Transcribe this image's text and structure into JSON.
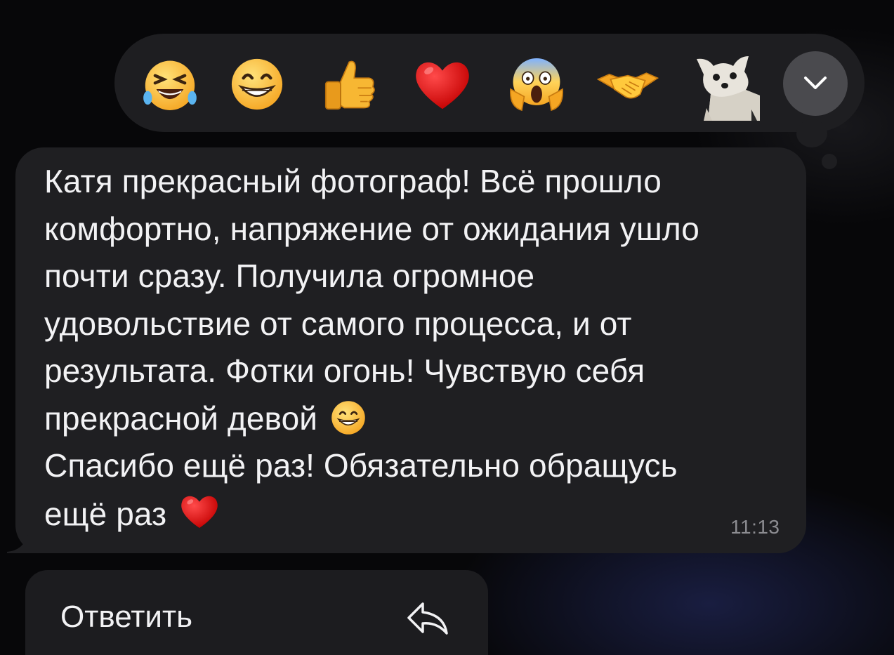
{
  "reactions": [
    {
      "name": "laughing-face-icon"
    },
    {
      "name": "grinning-face-icon"
    },
    {
      "name": "thumbs-up-icon"
    },
    {
      "name": "red-heart-icon"
    },
    {
      "name": "screaming-face-icon"
    },
    {
      "name": "handshake-icon"
    },
    {
      "name": "dog-sticker-icon"
    }
  ],
  "expand_icon": "chevron-down-icon",
  "message": {
    "lines": [
      "Катя прекрасный фотограф! Всё прошло",
      "комфортно, напряжение от ожидания ушло",
      "почти сразу. Получила огромное",
      "удовольствие от самого процесса, и от",
      "результата. Фотки огонь! Чувствую себя",
      "прекрасной девой",
      "Спасибо ещё раз! Обязательно обращусь",
      "ещё раз"
    ],
    "inline_emojis": [
      "grinning-face-icon",
      "red-heart-icon"
    ],
    "time": "11:13"
  },
  "context_menu": {
    "reply_label": "Ответить",
    "reply_icon": "reply-arrow-icon"
  },
  "colors": {
    "bubble": "#1f1f22",
    "reaction_bar": "#1e1e21",
    "text": "#f2f2f4",
    "timestamp": "#8c8c91",
    "expand_button": "#4a4a4e"
  }
}
